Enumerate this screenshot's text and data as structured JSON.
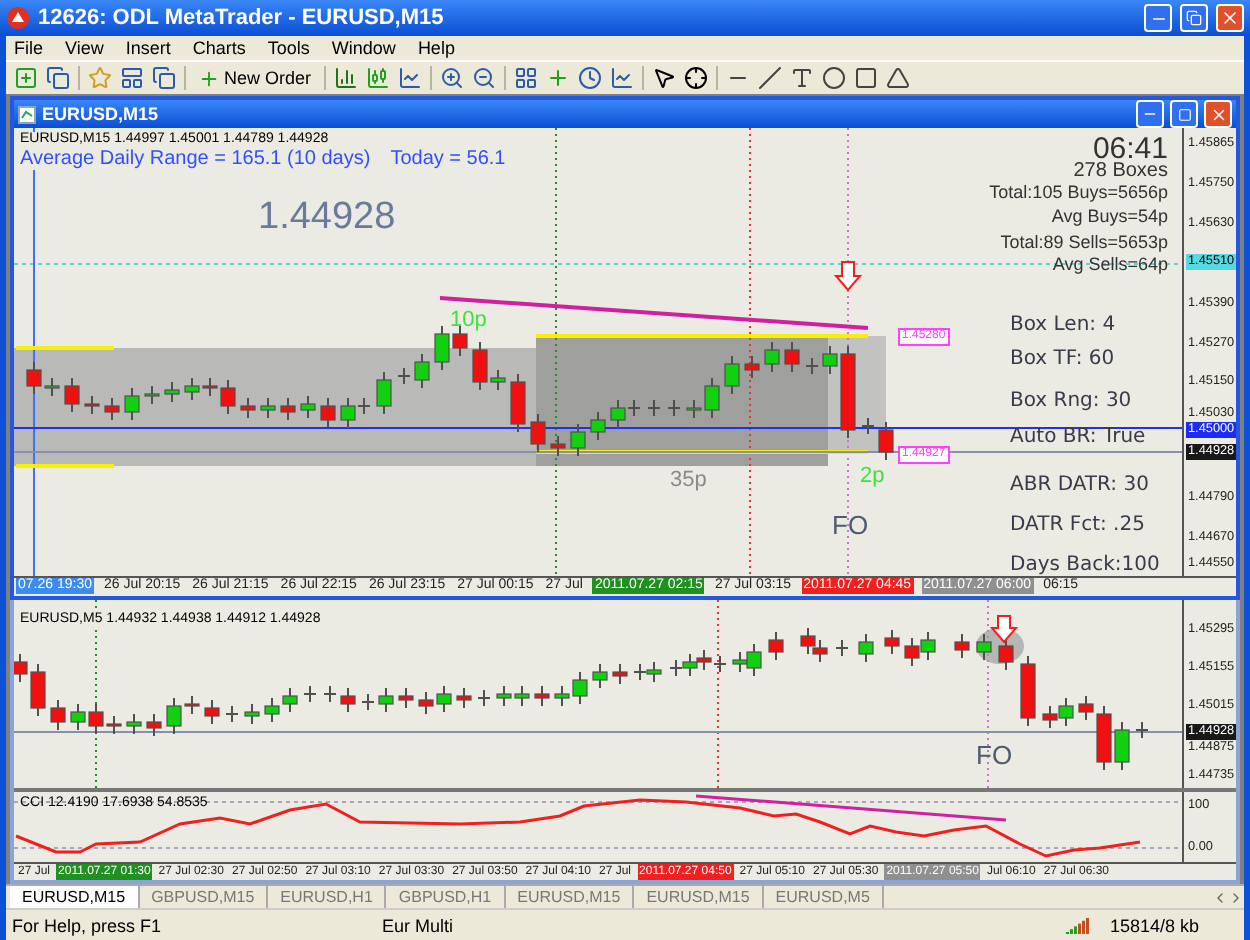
{
  "window": {
    "title": "12626: ODL MetaTrader - EURUSD,M15"
  },
  "menu": [
    "File",
    "View",
    "Insert",
    "Charts",
    "Tools",
    "Window",
    "Help"
  ],
  "toolbar": {
    "new_order": "New Order"
  },
  "upper_chart": {
    "title": "EURUSD,M15",
    "quote": "EURUSD,M15  1.44997 1.45001 1.44789 1.44928",
    "range_line": "Average Daily Range = 165.1 (10 days)",
    "today": "Today = 56.1",
    "last_price": "1.44928",
    "clock": "06:41",
    "boxes": "278 Boxes",
    "stats": [
      "Total:105 Buys=5656p",
      "Avg Buys=54p",
      "Total:89 Sells=5653p",
      "Avg Sells=64p"
    ],
    "settings": [
      "Box Len: 4",
      "Box TF: 60",
      "Box Rng: 30",
      "Auto BR: True",
      "ABR DATR: 30",
      "DATR Fct: .25",
      "Days Back:100"
    ],
    "pip_labels": [
      {
        "text": "10p",
        "color": "#40e040"
      },
      {
        "text": "35p",
        "color": "#8a8a8a"
      },
      {
        "text": "2p",
        "color": "#40e040"
      }
    ],
    "signal_label": "FO",
    "line_tags": [
      "1.45280",
      "1.44927"
    ],
    "price_axis": [
      {
        "text": "1.45865"
      },
      {
        "text": "1.45750"
      },
      {
        "text": "1.45630"
      },
      {
        "text": "1.45510",
        "color": "#58d8e0"
      },
      {
        "text": "1.45390"
      },
      {
        "text": "1.45270"
      },
      {
        "text": "1.45150"
      },
      {
        "text": "1.45030"
      },
      {
        "text": "1.45000",
        "color": "#1c2cf0"
      },
      {
        "text": "1.44928",
        "color": "#181818"
      },
      {
        "text": "1.44790"
      },
      {
        "text": "1.44670"
      },
      {
        "text": "1.44550"
      }
    ],
    "time_axis": [
      {
        "text": "07.26 19:30",
        "color": "#3c8cf0"
      },
      {
        "text": "26 Jul 20:15"
      },
      {
        "text": "26 Jul 21:15"
      },
      {
        "text": "26 Jul 22:15"
      },
      {
        "text": "26 Jul 23:15"
      },
      {
        "text": "27 Jul 00:15"
      },
      {
        "text": "27 Jul"
      },
      {
        "text": "2011.07.27 02:15",
        "color": "#209020"
      },
      {
        "text": "27 Jul 03:15"
      },
      {
        "text": "2011.07.27 04:45",
        "color": "#f02020"
      },
      {
        "text": "2011.07.27 06:00",
        "color": "#909090"
      },
      {
        "text": "06:15"
      }
    ]
  },
  "lower_chart": {
    "quote": "EURUSD,M5  1.44932 1.44938 1.44912 1.44928",
    "signal_label": "FO",
    "price_axis": [
      {
        "text": "1.45295"
      },
      {
        "text": "1.45155"
      },
      {
        "text": "1.45015"
      },
      {
        "text": "1.44928",
        "color": "#181818"
      },
      {
        "text": "1.44875"
      },
      {
        "text": "1.44735"
      }
    ],
    "indicator": {
      "label": "CCI 12.4190 17.6938 54.8535",
      "axis": [
        "100",
        "0.00"
      ]
    },
    "time_axis": [
      {
        "text": "27 Jul"
      },
      {
        "text": "2011.07.27 01:30",
        "color": "#209020"
      },
      {
        "text": "27 Jul 02:30"
      },
      {
        "text": "27 Jul 02:50"
      },
      {
        "text": "27 Jul 03:10"
      },
      {
        "text": "27 Jul 03:30"
      },
      {
        "text": "27 Jul 03:50"
      },
      {
        "text": "27 Jul 04:10"
      },
      {
        "text": "27 Jul"
      },
      {
        "text": "2011.07.27 04:50",
        "color": "#f02020"
      },
      {
        "text": "27 Jul 05:10"
      },
      {
        "text": "27 Jul 05:30"
      },
      {
        "text": "2011.07.27 05:50",
        "color": "#909090"
      },
      {
        "text": "Jul 06:10"
      },
      {
        "text": "27 Jul 06:30"
      }
    ]
  },
  "tabs": [
    {
      "label": "EURUSD,M15",
      "selected": true
    },
    {
      "label": "GBPUSD,M15",
      "selected": false
    },
    {
      "label": "EURUSD,H1",
      "selected": false
    },
    {
      "label": "GBPUSD,H1",
      "selected": false
    },
    {
      "label": "EURUSD,M15",
      "selected": false
    },
    {
      "label": "EURUSD,M15",
      "selected": false
    },
    {
      "label": "EURUSD,M5",
      "selected": false
    }
  ],
  "status_bar": [
    "For Help, press F1",
    "Eur Multi",
    "15814/8 kb"
  ]
}
